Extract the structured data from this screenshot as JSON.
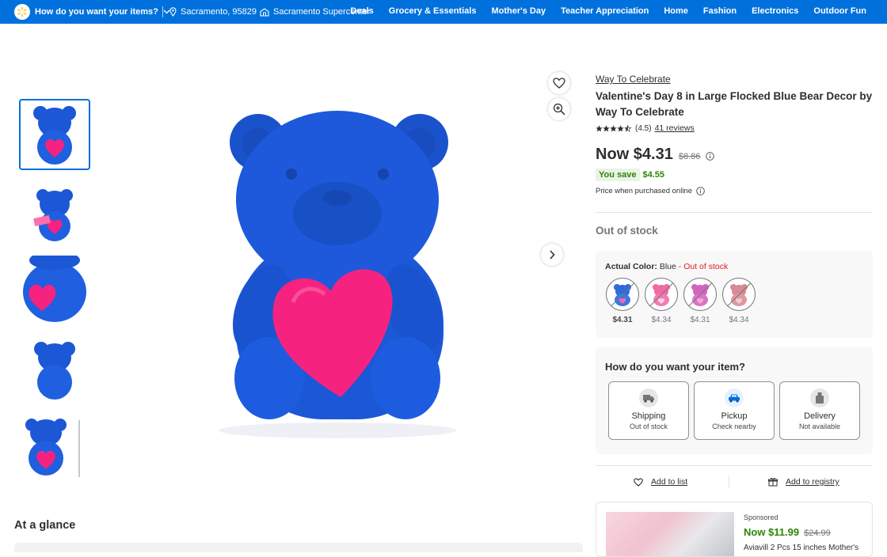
{
  "header": {
    "intent": "How do you want your items?",
    "location": "Sacramento, 95829",
    "store": "Sacramento Supercenter",
    "nav": [
      "Deals",
      "Grocery & Essentials",
      "Mother's Day",
      "Teacher Appreciation",
      "Home",
      "Fashion",
      "Electronics",
      "Outdoor Fun"
    ]
  },
  "product": {
    "brand": "Way To Celebrate",
    "title": "Valentine's Day 8 in Large Flocked Blue Bear Decor by Way To Celebrate",
    "rating_value": 4.5,
    "rating_text": "(4.5)",
    "reviews": "41 reviews",
    "now_price": "Now $4.31",
    "was_price": "$8.86",
    "you_save_label": "You save",
    "you_save_amount": "$4.55",
    "price_note": "Price when purchased online",
    "stock_status": "Out of stock"
  },
  "variants": {
    "label": "Actual Color:",
    "selected": "Blue",
    "status": "- Out of stock",
    "options": [
      {
        "price": "$4.31",
        "color": "#2f6bd8",
        "selected": true
      },
      {
        "price": "$4.34",
        "color": "#f06aa6",
        "selected": false
      },
      {
        "price": "$4.31",
        "color": "#d463c0",
        "selected": false
      },
      {
        "price": "$4.34",
        "color": "#d88a95",
        "selected": false
      }
    ]
  },
  "fulfillment": {
    "title": "How do you want your item?",
    "options": [
      {
        "label": "Shipping",
        "status": "Out of stock",
        "icon": "truck-icon"
      },
      {
        "label": "Pickup",
        "status": "Check nearby",
        "icon": "car-icon"
      },
      {
        "label": "Delivery",
        "status": "Not available",
        "icon": "bag-icon"
      }
    ]
  },
  "actions": {
    "add_to_list": "Add to list",
    "add_to_registry": "Add to registry"
  },
  "sponsored": {
    "label": "Sponsored",
    "now_price": "Now $11.99",
    "was_price": "$24.99",
    "desc": "Aviavill 2 Pcs 15 inches Mother's"
  },
  "section": {
    "at_a_glance": "At a glance"
  },
  "colors": {
    "brand_blue": "#0071dc",
    "save_green": "#2a8703",
    "oos_red": "#de1c24",
    "bear_blue": "#1c57d6",
    "heart_pink": "#f5237f"
  }
}
